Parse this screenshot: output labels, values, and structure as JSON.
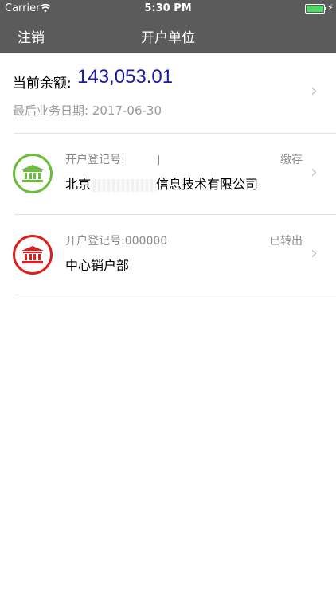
{
  "status_bar": {
    "carrier": "Carrier",
    "time": "5:30 PM"
  },
  "nav": {
    "left_label": "注销",
    "title": "开户单位"
  },
  "balance": {
    "label": "当前余额:",
    "value": "143,053.01",
    "last_date_text": "最后业务日期: 2017-06-30"
  },
  "units": [
    {
      "reg_label": "开户登记号:",
      "status": "缴存",
      "name_prefix": "北京",
      "name_suffix": "信息技术有限公司",
      "icon_color": "#6abf3a"
    },
    {
      "reg_label": "开户登记号:000000",
      "status": "已转出",
      "name": "中心销户部",
      "icon_color": "#e01d1d"
    }
  ],
  "colors": {
    "nav_background": "#5b5b5b",
    "balance_value": "#1a1aa8",
    "battery": "#4cd964"
  }
}
